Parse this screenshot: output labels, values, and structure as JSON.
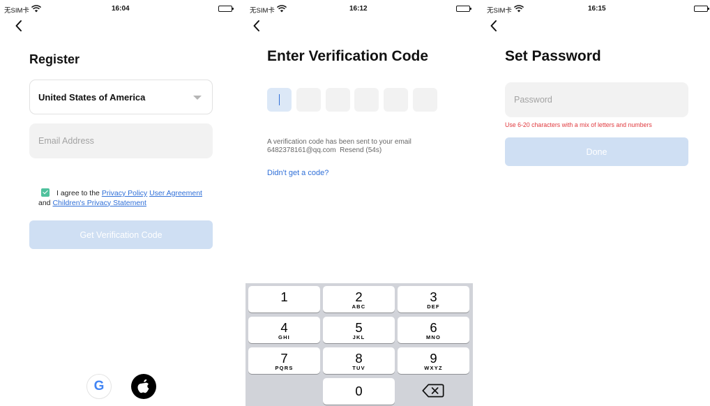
{
  "screens": [
    {
      "status": {
        "carrier": "无SIM卡",
        "time": "16:04"
      },
      "title": "Register",
      "country_select": {
        "value": "United States of America"
      },
      "email_input": {
        "placeholder": "Email Address",
        "value": ""
      },
      "agreement": {
        "checked": true,
        "prefix": "I agree to the",
        "privacy_policy": "Privacy Policy",
        "user_agreement": "User Agreement",
        "and": "and",
        "childrens_privacy": "Children's Privacy Statement"
      },
      "primary_button": "Get Verification Code",
      "social_logins": [
        {
          "icon": "google-icon",
          "glyph": "G"
        },
        {
          "icon": "apple-icon"
        }
      ]
    },
    {
      "status": {
        "carrier": "无SIM卡",
        "time": "16:12"
      },
      "title": "Enter Verification Code",
      "code_boxes": 6,
      "info_line1": "A verification code has been sent to your email",
      "info_line2": "6482378161@qq.com  Resend (54s)",
      "didnt_get": "Didn't get a code?",
      "keyboard": {
        "keys": [
          {
            "num": "1",
            "letters": ""
          },
          {
            "num": "2",
            "letters": "ABC"
          },
          {
            "num": "3",
            "letters": "DEF"
          },
          {
            "num": "4",
            "letters": "GHI"
          },
          {
            "num": "5",
            "letters": "JKL"
          },
          {
            "num": "6",
            "letters": "MNO"
          },
          {
            "num": "7",
            "letters": "PQRS"
          },
          {
            "num": "8",
            "letters": "TUV"
          },
          {
            "num": "9",
            "letters": "WXYZ"
          },
          {
            "num": "0",
            "letters": ""
          }
        ],
        "delete_icon": "backspace-icon"
      }
    },
    {
      "status": {
        "carrier": "无SIM卡",
        "time": "16:15"
      },
      "title": "Set Password",
      "password_input": {
        "placeholder": "Password",
        "value": ""
      },
      "hint": "Use 6-20 characters with a mix of letters and numbers",
      "primary_button": "Done"
    }
  ],
  "colors": {
    "accent_link": "#2f6fd8",
    "button_disabled": "#cfdff3",
    "checkbox": "#4fc19d",
    "error": "#e0393e",
    "field_bg": "#f2f2f2"
  }
}
